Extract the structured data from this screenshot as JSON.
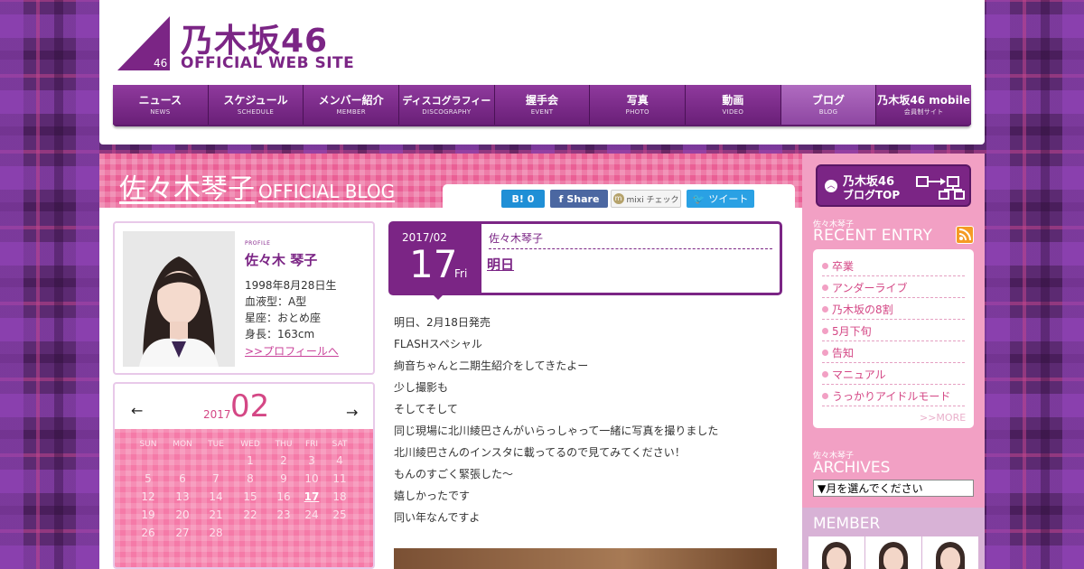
{
  "header": {
    "logo_jp": "乃木坂46",
    "logo_en": "OFFICIAL WEB SITE",
    "logo_badge": "46",
    "nav": [
      {
        "jp": "ニュース",
        "en": "NEWS"
      },
      {
        "jp": "スケジュール",
        "en": "SCHEDULE"
      },
      {
        "jp": "メンバー紹介",
        "en": "MEMBER"
      },
      {
        "jp": "ディスコグラフィー",
        "en": "DISCOGRAPHY"
      },
      {
        "jp": "握手会",
        "en": "EVENT"
      },
      {
        "jp": "写真",
        "en": "PHOTO"
      },
      {
        "jp": "動画",
        "en": "VIDEO"
      },
      {
        "jp": "ブログ",
        "en": "BLOG"
      },
      {
        "jp": "乃木坂46 mobile",
        "en": "会員制サイト"
      }
    ],
    "active_nav": "BLOG"
  },
  "blog": {
    "name": "佐々木琴子",
    "subtitle": "OFFICIAL BLOG"
  },
  "social": {
    "hatena": "B! 0",
    "facebook": "Share",
    "mixi": "mixi チェック",
    "twitter": "ツイート"
  },
  "profile": {
    "label": "PROFILE",
    "name": "佐々木 琴子",
    "birth": "1998年8月28日生",
    "blood": "血液型：A型",
    "sign": "星座：おとめ座",
    "height": "身長：163cm",
    "link": ">>プロフィールへ"
  },
  "calendar": {
    "prev": "←",
    "next": "→",
    "year": "2017",
    "month": "02",
    "weekdays": [
      "SUN",
      "MON",
      "TUE",
      "WED",
      "THU",
      "FRI",
      "SAT"
    ],
    "weeks": [
      [
        "",
        "",
        "",
        "1",
        "2",
        "3",
        "4"
      ],
      [
        "5",
        "6",
        "7",
        "8",
        "9",
        "10",
        "11"
      ],
      [
        "12",
        "13",
        "14",
        "15",
        "16",
        "17",
        "18"
      ],
      [
        "19",
        "20",
        "21",
        "22",
        "23",
        "24",
        "25"
      ],
      [
        "26",
        "27",
        "28",
        "",
        "",
        "",
        ""
      ]
    ],
    "today": "17"
  },
  "entry": {
    "year_month": "2017/02",
    "day": "17",
    "dow": "Fri",
    "author": "佐々木琴子",
    "title": "明日",
    "body": [
      "明日、2月18日発売",
      "FLASHスペシャル",
      "絢音ちゃんと二期生紹介をしてきたよー",
      "少し撮影も",
      "そしてそして",
      "同じ現場に北川綾巴さんがいらっしゃって一緒に写真を撮りました",
      "北川綾巴さんのインスタに載ってるので見てみてください！",
      "もんのすごく緊張した～",
      "嬉しかったです",
      "同い年なんですよ"
    ]
  },
  "sidebar": {
    "top_btn_l1": "乃木坂46",
    "top_btn_l2": "ブログTOP",
    "recent_small": "佐々木琴子",
    "recent_title": "RECENT ENTRY",
    "recent": [
      "卒業",
      "アンダーライブ",
      "乃木坂の8割",
      "5月下旬",
      "告知",
      "マニュアル",
      "うっかりアイドルモード"
    ],
    "more": ">>MORE",
    "archives_small": "佐々木琴子",
    "archives_title": "ARCHIVES",
    "archives_select": "▼月を選んでください",
    "member_title": "MEMBER"
  },
  "colors": {
    "brand_purple": "#7b2585",
    "pink": "#ea5f95",
    "sidebar_pink": "#f2a0c4"
  }
}
